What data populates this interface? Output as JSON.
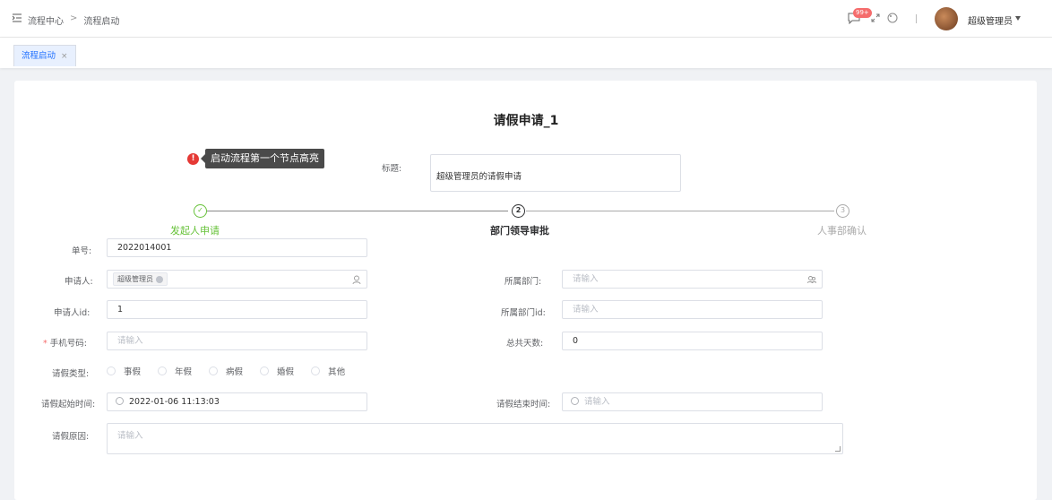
{
  "header": {
    "breadcrumb": [
      "流程中心",
      ">",
      "流程启动"
    ],
    "badge": "99+",
    "user_name": "超级管理员"
  },
  "tabs": [
    {
      "label": "流程启动",
      "close": "×"
    }
  ],
  "form": {
    "title": "请假申请_1",
    "tooltip": "启动流程第一个节点高亮",
    "warn_symbol": "!",
    "title_label": "标题:",
    "title_value": "超级管理员的请假申请"
  },
  "steps": [
    {
      "label": "发起人申请",
      "status": "finish",
      "symbol": "✓"
    },
    {
      "label": "部门领导审批",
      "status": "process",
      "symbol": "2"
    },
    {
      "label": "人事部确认",
      "status": "wait",
      "symbol": "3"
    }
  ],
  "fields": {
    "order_no": {
      "label": "单号:",
      "value": "2022014001"
    },
    "applicant": {
      "label": "申请人:",
      "tag": "超级管理员"
    },
    "dept": {
      "label": "所属部门:",
      "placeholder": "请输入"
    },
    "applicant_id": {
      "label": "申请人id:",
      "value": "1"
    },
    "dept_id": {
      "label": "所属部门id:",
      "placeholder": "请输入"
    },
    "phone": {
      "label": "手机号码:",
      "required": "*",
      "placeholder": "请输入"
    },
    "total_days": {
      "label": "总共天数:",
      "value": "0"
    },
    "leave_type": {
      "label": "请假类型:",
      "options": [
        "事假",
        "年假",
        "病假",
        "婚假",
        "其他"
      ]
    },
    "start_time": {
      "label": "请假起始时间:",
      "value": "2022-01-06 11:13:03"
    },
    "end_time": {
      "label": "请假结束时间:",
      "placeholder": "请输入"
    },
    "reason": {
      "label": "请假原因:",
      "placeholder": "请输入"
    }
  },
  "colors": {
    "primary": "#1e6fff",
    "success": "#67c23a",
    "danger": "#f56c6c"
  }
}
